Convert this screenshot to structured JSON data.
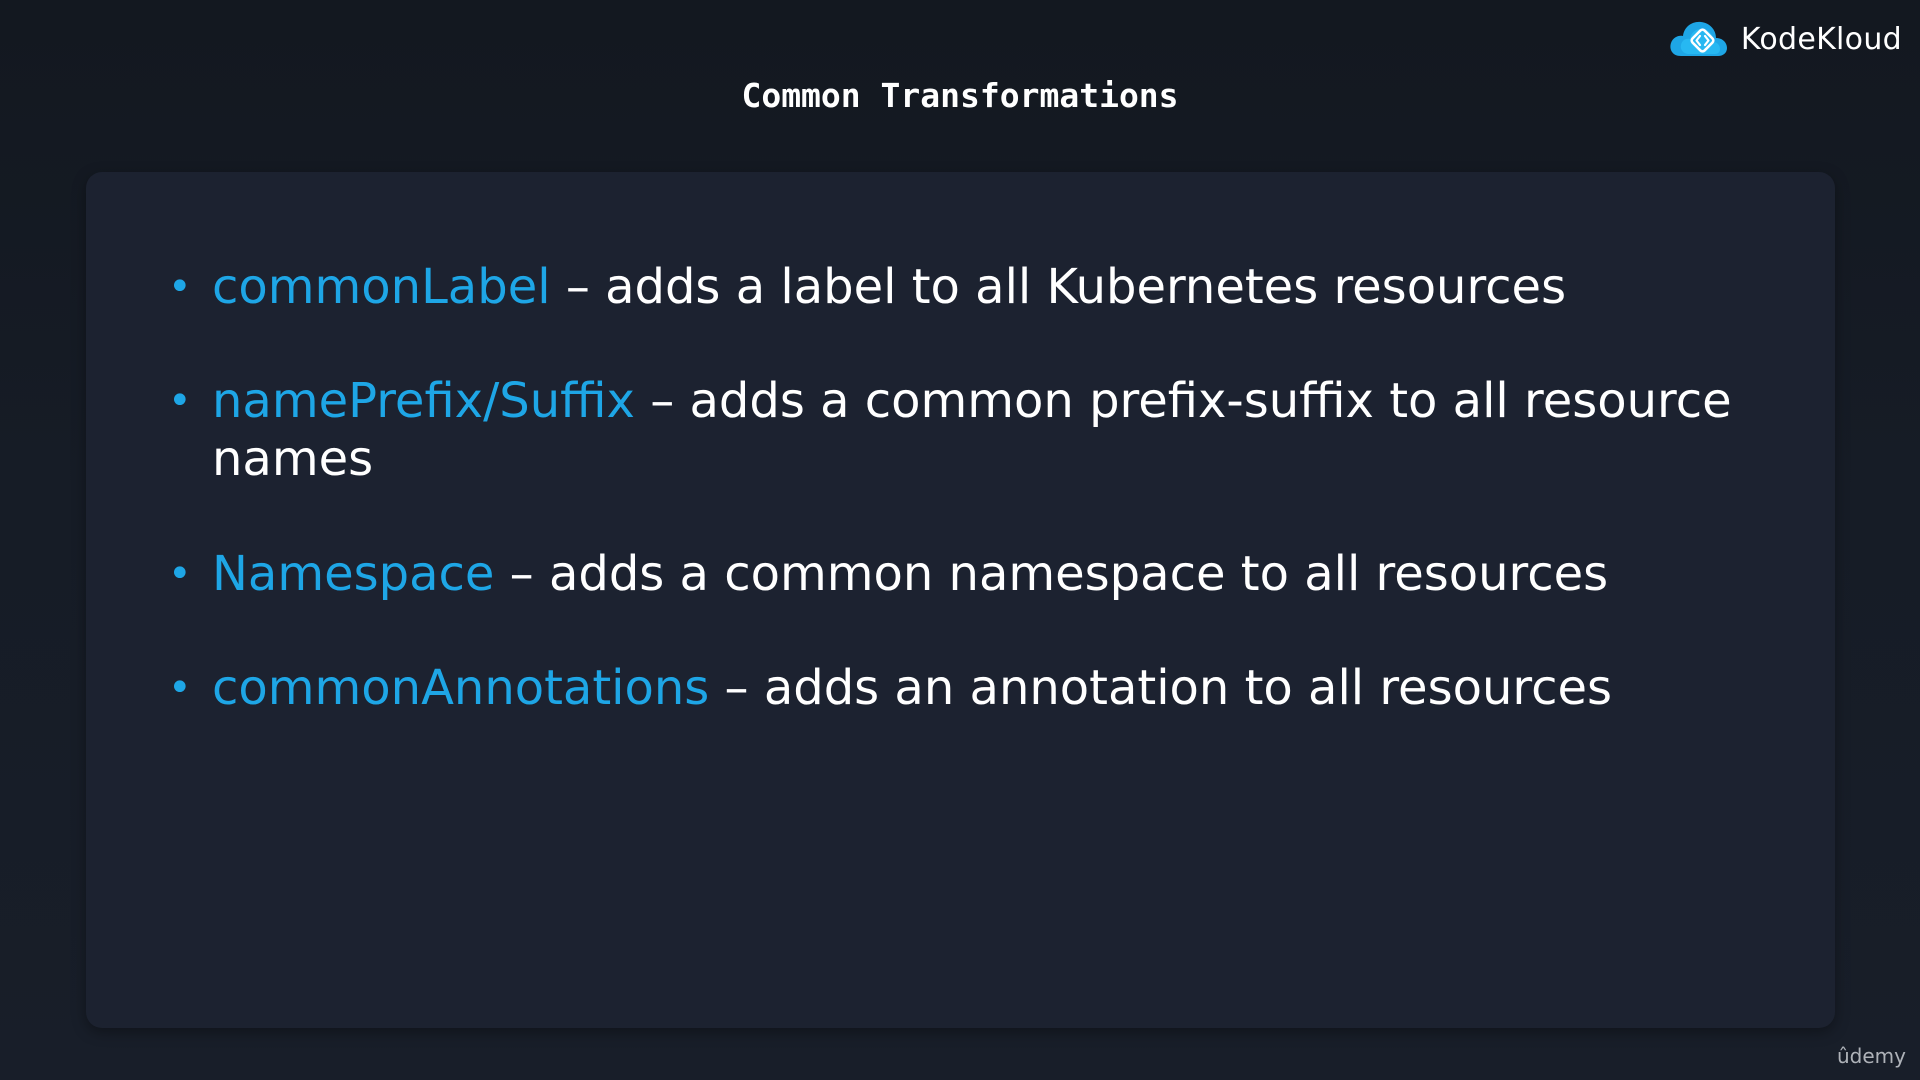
{
  "slide": {
    "title": "Common Transformations"
  },
  "brand": {
    "name": "KodeKloud",
    "icon": "kodekloud-cloud-code-icon",
    "accent": "#1ea6e6"
  },
  "bullets": [
    {
      "key": "commonLabel",
      "text": " – adds a label to all Kubernetes resources"
    },
    {
      "key": "namePrefix/Suffix",
      "text": " – adds a common prefix-suffix to all resource names"
    },
    {
      "key": "Namespace",
      "text": " – adds a common namespace to all resources"
    },
    {
      "key": "commonAnnotations",
      "text": " – adds an annotation to all resources"
    }
  ],
  "bullet_symbol": "•",
  "watermark": {
    "text": "ûdemy"
  },
  "colors": {
    "background": "#151b24",
    "card": "#1c2230",
    "highlight": "#1ea6e6",
    "text": "#ffffff"
  }
}
